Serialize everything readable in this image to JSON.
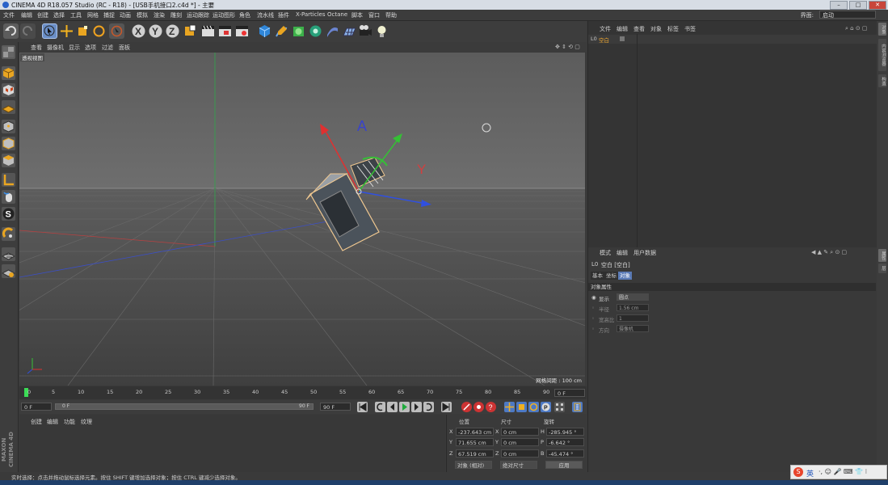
{
  "window": {
    "title": "CINEMA 4D R18.057 Studio (RC - R18) - [USB手机接口2.c4d *] - 主要"
  },
  "menu": [
    "文件",
    "编辑",
    "创建",
    "选择",
    "工具",
    "网格",
    "捕捉",
    "动画",
    "模拟",
    "渲染",
    "雕刻",
    "运动跟踪",
    "运动图形",
    "角色",
    "流水线",
    "插件",
    "X-Particles",
    "Octane",
    "脚本",
    "窗口",
    "帮助"
  ],
  "layout": {
    "label": "界面:",
    "value": "启动"
  },
  "viewport": {
    "menu": [
      "查看",
      "摄像机",
      "显示",
      "选项",
      "过滤",
      "面板"
    ],
    "label": "透视视图",
    "grid_spacing": "网格间距 : 100 cm",
    "gizmo_letters": {
      "y": "A",
      "x": "Y"
    }
  },
  "timeline": {
    "ticks": [
      "0",
      "5",
      "10",
      "15",
      "20",
      "25",
      "30",
      "35",
      "40",
      "45",
      "50",
      "55",
      "60",
      "65",
      "70",
      "75",
      "80",
      "85",
      "90"
    ],
    "current_frame": "0 F",
    "start_frame": "0 F",
    "range_start": "0 F",
    "range_end_inner": "90 F",
    "end_frame": "90 F"
  },
  "material_panel": {
    "menu": [
      "创建",
      "编辑",
      "功能",
      "纹理"
    ]
  },
  "coordinates": {
    "headers": {
      "position": "位置",
      "size": "尺寸",
      "rotation": "旋转"
    },
    "rows": [
      {
        "axis": "X",
        "pos": "-237.643 cm",
        "size_axis": "X",
        "size": "0 cm",
        "rot_axis": "H",
        "rot": "-285.945 °"
      },
      {
        "axis": "Y",
        "pos": "71.655 cm",
        "size_axis": "Y",
        "size": "0 cm",
        "rot_axis": "P",
        "rot": "-6.642 °"
      },
      {
        "axis": "Z",
        "pos": "67.519 cm",
        "size_axis": "Z",
        "size": "0 cm",
        "rot_axis": "B",
        "rot": "-45.474 °"
      }
    ],
    "mode_select": "对象 (相对)",
    "size_select": "绝对尺寸",
    "apply_button": "应用"
  },
  "object_manager": {
    "menu": [
      "文件",
      "编辑",
      "查看",
      "对象",
      "标签",
      "书签"
    ],
    "object_name": "空白"
  },
  "attribute_manager": {
    "menu": [
      "模式",
      "编辑",
      "用户数据"
    ],
    "object_title": "空白 [空白]",
    "tabs": [
      "基本",
      "坐标",
      "对象"
    ],
    "section": "对象属性",
    "fields": [
      {
        "label": "显示",
        "value": "圆点"
      },
      {
        "label": "半径",
        "value": "1.56 cm"
      },
      {
        "label": "宽高比",
        "value": "1"
      },
      {
        "label": "方向",
        "value": "摄像机"
      }
    ]
  },
  "right_tabs": [
    "对象",
    "内容浏览器",
    "构造",
    "属性",
    "层"
  ],
  "status": {
    "text": "实时选择：点击并拖动鼠标选择元素。按住 SHIFT 键增加选择对象；按住 CTRL 键减少选择对象。"
  },
  "brand": {
    "line1": "MAXON",
    "line2": "CINEMA 4D"
  },
  "ime": {
    "label": "英"
  }
}
